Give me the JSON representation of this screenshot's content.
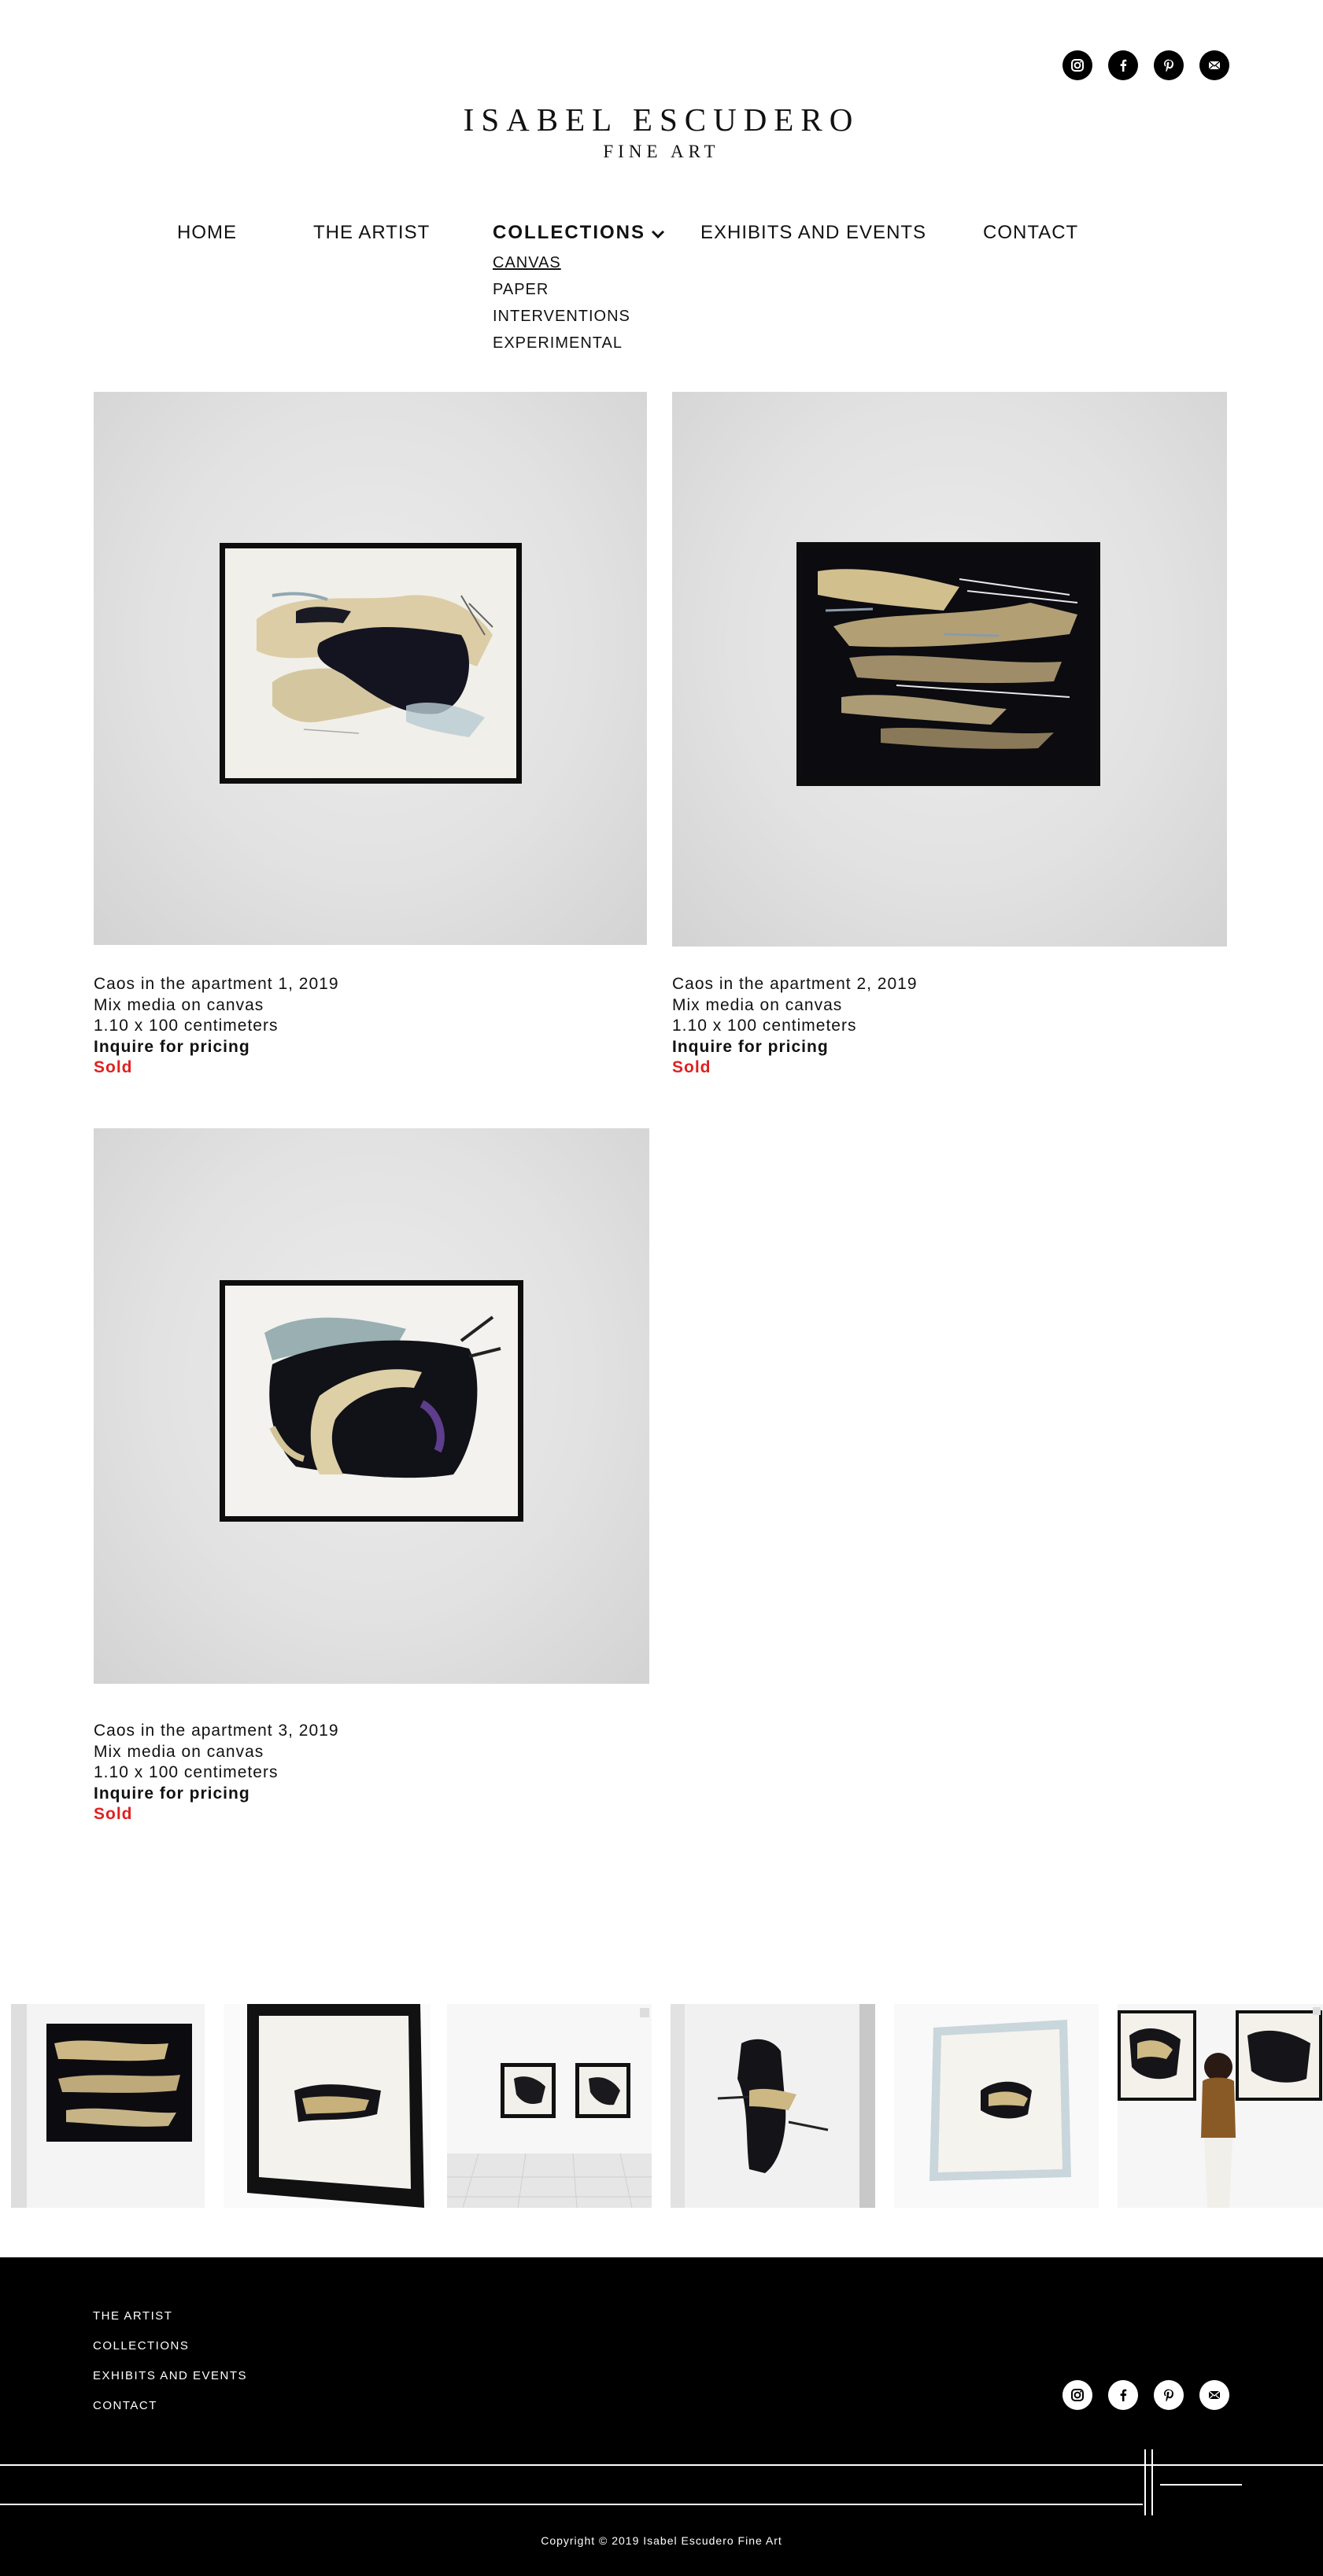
{
  "brand": {
    "name": "ISABEL ESCUDERO",
    "subtitle": "FINE ART"
  },
  "social": [
    {
      "icon": "instagram-icon"
    },
    {
      "icon": "facebook-icon"
    },
    {
      "icon": "pinterest-icon"
    },
    {
      "icon": "email-icon"
    }
  ],
  "nav": {
    "home": "HOME",
    "artist": "THE ARTIST",
    "collections": "COLLECTIONS",
    "exhibits": "EXHIBITS AND EVENTS",
    "contact": "CONTACT"
  },
  "submenu": {
    "canvas": "CANVAS",
    "paper": "PAPER",
    "interventions": "INTERVENTIONS",
    "experimental": "EXPERIMENTAL"
  },
  "artworks": [
    {
      "title": "Caos in the apartment 1, 2019",
      "medium": "Mix media on canvas",
      "size": "1.10 x 100 centimeters",
      "price": "Inquire for pricing",
      "status": "Sold"
    },
    {
      "title": "Caos in the apartment 2, 2019",
      "medium": "Mix media on canvas",
      "size": "1.10 x 100 centimeters",
      "price": "Inquire for pricing",
      "status": "Sold"
    },
    {
      "title": "Caos in the apartment 3, 2019",
      "medium": "Mix media on canvas",
      "size": "1.10 x 100 centimeters",
      "price": "Inquire for pricing",
      "status": "Sold"
    }
  ],
  "footer": {
    "links": {
      "artist": "THE ARTIST",
      "collections": "COLLECTIONS",
      "exhibits": "EXHIBITS AND EVENTS",
      "contact": "CONTACT"
    },
    "copyright": "Copyright © 2019 Isabel Escudero Fine Art"
  },
  "colors": {
    "sold": "#e02020",
    "footer_bg": "#000000",
    "text": "#111111"
  }
}
